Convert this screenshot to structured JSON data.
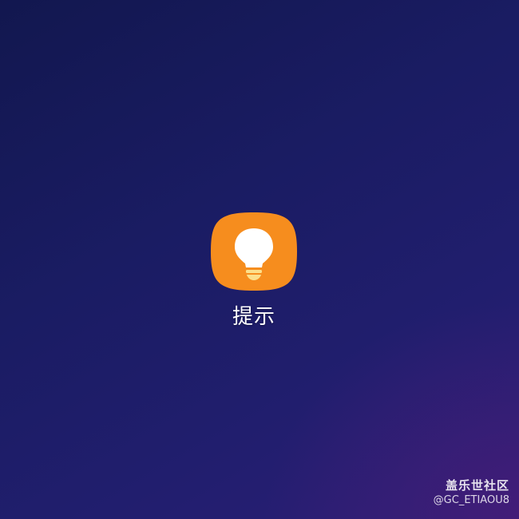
{
  "app": {
    "label": "提示",
    "icon": "lightbulb-icon",
    "icon_bg_color": "#f68d1e",
    "bulb_color": "#ffffff",
    "base_color": "#fce08c"
  },
  "watermark": {
    "title": "盖乐世社区",
    "handle": "@GC_ETIAOU8"
  },
  "colors": {
    "wallpaper_top": "#12174f",
    "wallpaper_bottom_right": "#461c78",
    "label_text": "#ffffff"
  }
}
